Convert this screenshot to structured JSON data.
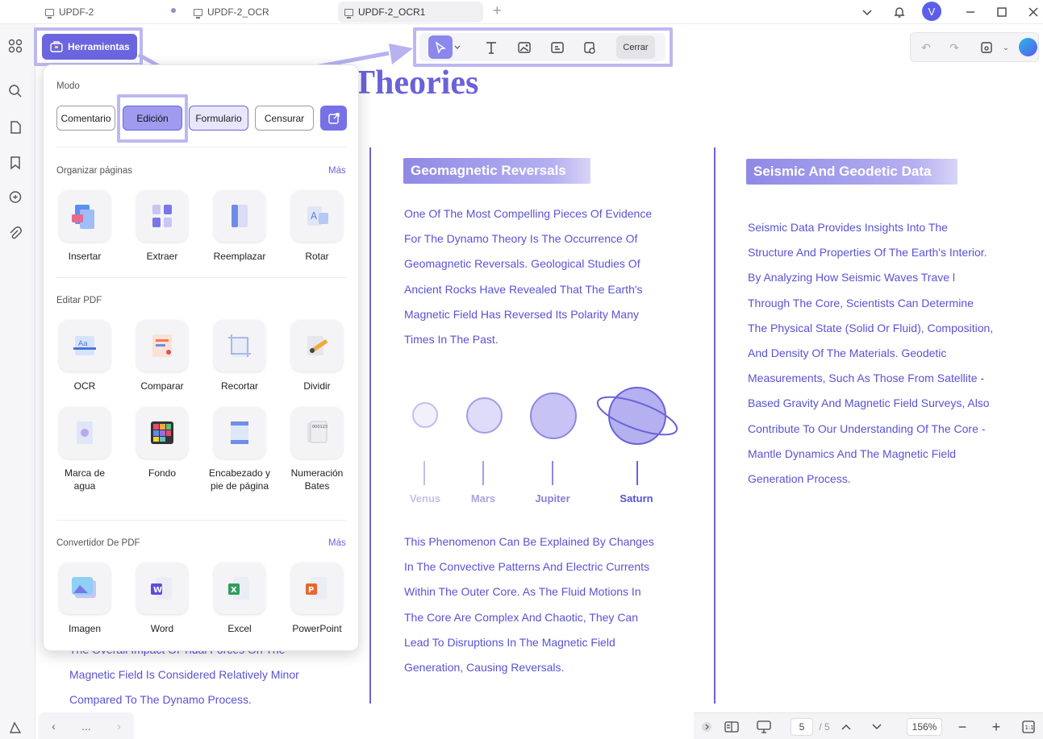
{
  "tabs": [
    {
      "label": "UPDF-2",
      "active": false
    },
    {
      "label": "UPDF-2_OCR",
      "active": false
    },
    {
      "label": "UPDF-2_OCR1",
      "active": true
    }
  ],
  "user": {
    "avatar_letter": "V"
  },
  "toolbar": {
    "herramientas_label": "Herramientas",
    "cerrar_label": "Cerrar"
  },
  "panel": {
    "mode_label": "Modo",
    "modes": [
      "Comentario",
      "Edición",
      "Formulario",
      "Censurar"
    ],
    "active_mode": "Edición",
    "organize": {
      "title": "Organizar páginas",
      "more": "Más",
      "tools": [
        "Insertar",
        "Extraer",
        "Reemplazar",
        "Rotar"
      ]
    },
    "edit": {
      "title": "Editar PDF",
      "tools": [
        "OCR",
        "Comparar",
        "Recortar",
        "Dividir",
        "Marca de agua",
        "Fondo",
        "Encabezado y pie de página",
        "Numeración Bates"
      ]
    },
    "convert": {
      "title": "Convertidor De PDF",
      "more": "Más",
      "tools": [
        "Imagen",
        "Word",
        "Excel",
        "PowerPoint"
      ]
    }
  },
  "document": {
    "heading": "Theories",
    "left_lines": [
      "The Overall Impact Of Tidal Forces On The",
      "Magnetic Field Is Considered Relatively Minor",
      "Compared To The Dynamo Process."
    ],
    "col1": {
      "title": "Geomagnetic Reversals",
      "lines": [
        "One Of The Most Compelling Pieces Of Evidence",
        "For The Dynamo Theory Is The Occurrence Of",
        "Geomagnetic Reversals. Geological Studies Of",
        "Ancient Rocks Have Revealed That The Earth's",
        "Magnetic Field Has Reversed Its Polarity Many",
        "Times In The Past."
      ],
      "planets": [
        "Venus",
        "Mars",
        "Jupiter",
        "Saturn"
      ],
      "lines2": [
        "This Phenomenon Can Be Explained By Changes",
        "In The Convective Patterns And Electric Currents",
        "Within The Outer Core. As The Fluid Motions In",
        "The Core Are Complex And Chaotic, They Can",
        "Lead To Disruptions In The Magnetic Field",
        "Generation, Causing Reversals."
      ]
    },
    "col2": {
      "title": "Seismic And Geodetic Data",
      "lines": [
        "Seismic Data Provides Insights Into The",
        "Structure And Properties Of The Earth's Interior.",
        "By Analyzing How Seismic Waves Trave l",
        "Through The Core, Scientists Can Determine",
        "The Physical State (Solid Or Fluid), Composition,",
        "And Density Of The Materials. Geodetic",
        "Measurements, Such As Those From Satellite -",
        "Based Gravity And Magnetic Field Surveys, Also",
        "Contribute To Our Understanding Of The Core -",
        "Mantle Dynamics And The Magnetic Field",
        "Generation Process."
      ]
    }
  },
  "statusbar": {
    "page_current": "5",
    "page_total": "/ 5",
    "zoom": "156%",
    "dots": "..."
  }
}
